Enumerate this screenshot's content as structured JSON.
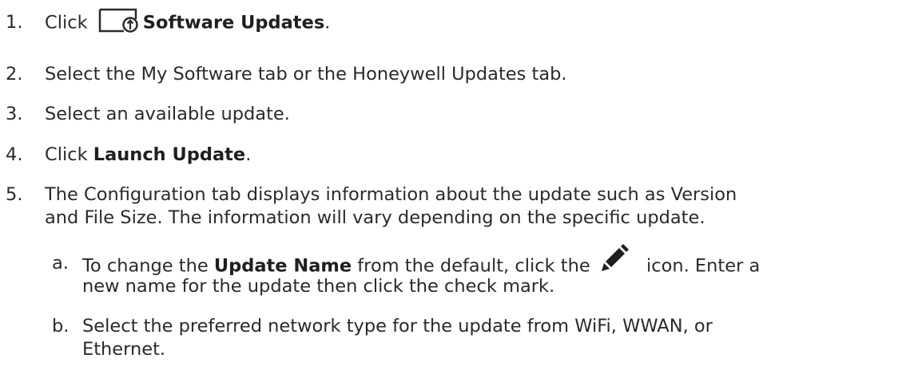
{
  "steps": [
    {
      "num": "1.",
      "pre": "Click",
      "bold": "Software Updates",
      "post": ".",
      "icon": "software-update-icon"
    },
    {
      "num": "2.",
      "text": "Select the My Software tab or the Honeywell Updates tab."
    },
    {
      "num": "3.",
      "text": "Select an available update."
    },
    {
      "num": "4.",
      "pre": "Click ",
      "bold": "Launch Update",
      "post": "."
    },
    {
      "num": "5.",
      "line1": "The Configuration tab displays information about the update such as Version",
      "line2": "and File Size. The information will vary depending on the specific update."
    }
  ],
  "substeps": [
    {
      "letter": "a.",
      "pre": "To change the ",
      "bold": "Update Name",
      "mid": " from the default, click the ",
      "icon": "pencil-icon",
      "post": " icon. Enter a",
      "line2": "new name for the update then click the check mark."
    },
    {
      "letter": "b.",
      "line1": "Select the preferred network type for the update from WiFi, WWAN, or",
      "line2": "Ethernet."
    }
  ]
}
